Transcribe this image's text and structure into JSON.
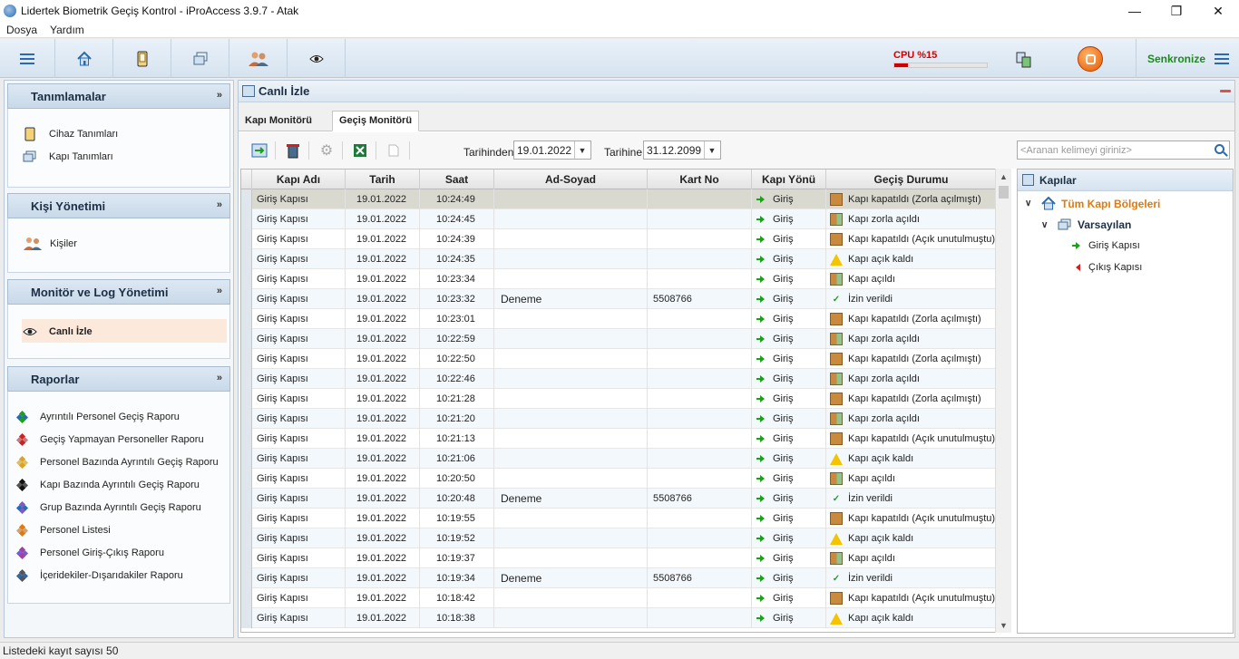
{
  "window": {
    "title": "Lidertek Biometrik Geçiş Kontrol - iProAccess 3.9.7 - Atak",
    "minimize_glyph": "—",
    "restore_glyph": "❐",
    "close_glyph": "✕"
  },
  "menu": {
    "items": [
      "Dosya",
      "Yardım"
    ]
  },
  "toolbar": {
    "cpu_label": "CPU  %15",
    "cpu_percent": 15,
    "sync_label": "Senkronize",
    "icons": [
      "menu-icon",
      "home-icon",
      "device-icon",
      "doors-icon",
      "users-icon",
      "eye-icon",
      "network-icon",
      "stop-icon"
    ]
  },
  "sidebar": {
    "sections": [
      {
        "title": "Tanımlamalar",
        "items": [
          "Cihaz Tanımları",
          "Kapı Tanımları"
        ]
      },
      {
        "title": "Kişi Yönetimi",
        "items": [
          "Kişiler"
        ]
      },
      {
        "title": "Monitör ve Log Yönetimi",
        "items": [
          "Canlı İzle"
        ]
      },
      {
        "title": "Raporlar",
        "items": [
          "Ayrıntılı Personel Geçiş Raporu",
          "Geçiş Yapmayan Personeller Raporu",
          "Personel Bazında Ayrıntılı Geçiş Raporu",
          "Kapı Bazında Ayrıntılı Geçiş Raporu",
          "Grup Bazında Ayrıntılı Geçiş Raporu",
          "Personel Listesi",
          "Personel Giriş-Çıkış Raporu",
          "İçeridekiler-Dışarıdakiler Raporu"
        ]
      }
    ],
    "chevron": "»"
  },
  "main": {
    "title": "Canlı İzle",
    "tabs": [
      "Kapı Monitörü",
      "Geçiş Monitörü"
    ],
    "active_tab": 1,
    "from_label": "Tarihinden",
    "from_date": "19.01.2022",
    "to_label": "Tarihine",
    "to_date": "31.12.2099",
    "search_placeholder": "<Aranan kelimeyi giriniz>",
    "columns": [
      "Kapı Adı",
      "Tarih",
      "Saat",
      "Ad-Soyad",
      "Kart No",
      "Kapı Yönü",
      "Geçiş Durumu"
    ],
    "rows": [
      {
        "door": "Giriş Kapısı",
        "date": "19.01.2022",
        "time": "10:24:49",
        "name": "",
        "card": "",
        "dir": "Giriş",
        "status": "Kapı kapatıldı (Zorla açılmıştı)",
        "icon": "closed"
      },
      {
        "door": "Giriş Kapısı",
        "date": "19.01.2022",
        "time": "10:24:45",
        "name": "",
        "card": "",
        "dir": "Giriş",
        "status": "Kapı zorla açıldı",
        "icon": "open"
      },
      {
        "door": "Giriş Kapısı",
        "date": "19.01.2022",
        "time": "10:24:39",
        "name": "",
        "card": "",
        "dir": "Giriş",
        "status": "Kapı kapatıldı (Açık unutulmuştu)",
        "icon": "closed"
      },
      {
        "door": "Giriş Kapısı",
        "date": "19.01.2022",
        "time": "10:24:35",
        "name": "",
        "card": "",
        "dir": "Giriş",
        "status": "Kapı açık kaldı",
        "icon": "warn"
      },
      {
        "door": "Giriş Kapısı",
        "date": "19.01.2022",
        "time": "10:23:34",
        "name": "",
        "card": "",
        "dir": "Giriş",
        "status": "Kapı açıldı",
        "icon": "open"
      },
      {
        "door": "Giriş Kapısı",
        "date": "19.01.2022",
        "time": "10:23:32",
        "name": "Deneme",
        "card": "5508766",
        "dir": "Giriş",
        "status": "İzin verildi",
        "icon": "ok"
      },
      {
        "door": "Giriş Kapısı",
        "date": "19.01.2022",
        "time": "10:23:01",
        "name": "",
        "card": "",
        "dir": "Giriş",
        "status": "Kapı kapatıldı (Zorla açılmıştı)",
        "icon": "closed"
      },
      {
        "door": "Giriş Kapısı",
        "date": "19.01.2022",
        "time": "10:22:59",
        "name": "",
        "card": "",
        "dir": "Giriş",
        "status": "Kapı zorla açıldı",
        "icon": "open"
      },
      {
        "door": "Giriş Kapısı",
        "date": "19.01.2022",
        "time": "10:22:50",
        "name": "",
        "card": "",
        "dir": "Giriş",
        "status": "Kapı kapatıldı (Zorla açılmıştı)",
        "icon": "closed"
      },
      {
        "door": "Giriş Kapısı",
        "date": "19.01.2022",
        "time": "10:22:46",
        "name": "",
        "card": "",
        "dir": "Giriş",
        "status": "Kapı zorla açıldı",
        "icon": "open"
      },
      {
        "door": "Giriş Kapısı",
        "date": "19.01.2022",
        "time": "10:21:28",
        "name": "",
        "card": "",
        "dir": "Giriş",
        "status": "Kapı kapatıldı (Zorla açılmıştı)",
        "icon": "closed"
      },
      {
        "door": "Giriş Kapısı",
        "date": "19.01.2022",
        "time": "10:21:20",
        "name": "",
        "card": "",
        "dir": "Giriş",
        "status": "Kapı zorla açıldı",
        "icon": "open"
      },
      {
        "door": "Giriş Kapısı",
        "date": "19.01.2022",
        "time": "10:21:13",
        "name": "",
        "card": "",
        "dir": "Giriş",
        "status": "Kapı kapatıldı (Açık unutulmuştu)",
        "icon": "closed"
      },
      {
        "door": "Giriş Kapısı",
        "date": "19.01.2022",
        "time": "10:21:06",
        "name": "",
        "card": "",
        "dir": "Giriş",
        "status": "Kapı açık kaldı",
        "icon": "warn"
      },
      {
        "door": "Giriş Kapısı",
        "date": "19.01.2022",
        "time": "10:20:50",
        "name": "",
        "card": "",
        "dir": "Giriş",
        "status": "Kapı açıldı",
        "icon": "open"
      },
      {
        "door": "Giriş Kapısı",
        "date": "19.01.2022",
        "time": "10:20:48",
        "name": "Deneme",
        "card": "5508766",
        "dir": "Giriş",
        "status": "İzin verildi",
        "icon": "ok"
      },
      {
        "door": "Giriş Kapısı",
        "date": "19.01.2022",
        "time": "10:19:55",
        "name": "",
        "card": "",
        "dir": "Giriş",
        "status": "Kapı kapatıldı (Açık unutulmuştu)",
        "icon": "closed"
      },
      {
        "door": "Giriş Kapısı",
        "date": "19.01.2022",
        "time": "10:19:52",
        "name": "",
        "card": "",
        "dir": "Giriş",
        "status": "Kapı açık kaldı",
        "icon": "warn"
      },
      {
        "door": "Giriş Kapısı",
        "date": "19.01.2022",
        "time": "10:19:37",
        "name": "",
        "card": "",
        "dir": "Giriş",
        "status": "Kapı açıldı",
        "icon": "open"
      },
      {
        "door": "Giriş Kapısı",
        "date": "19.01.2022",
        "time": "10:19:34",
        "name": "Deneme",
        "card": "5508766",
        "dir": "Giriş",
        "status": "İzin verildi",
        "icon": "ok"
      },
      {
        "door": "Giriş Kapısı",
        "date": "19.01.2022",
        "time": "10:18:42",
        "name": "",
        "card": "",
        "dir": "Giriş",
        "status": "Kapı kapatıldı (Açık unutulmuştu)",
        "icon": "closed"
      },
      {
        "door": "Giriş Kapısı",
        "date": "19.01.2022",
        "time": "10:18:38",
        "name": "",
        "card": "",
        "dir": "Giriş",
        "status": "Kapı açık kaldı",
        "icon": "warn"
      }
    ]
  },
  "tree": {
    "title": "Kapılar",
    "root": "Tüm Kapı Bölgeleri",
    "group": "Varsayılan",
    "doors": [
      {
        "label": "Giriş Kapısı",
        "dir": "in"
      },
      {
        "label": "Çıkış Kapısı",
        "dir": "out"
      }
    ]
  },
  "status": {
    "record_count_text": "Listedeki kayıt sayısı 50"
  },
  "colors": {
    "accent": "#2a6bb0",
    "cpu": "#d10000",
    "sync": "#1e8a1e",
    "root_node": "#e07a10"
  }
}
